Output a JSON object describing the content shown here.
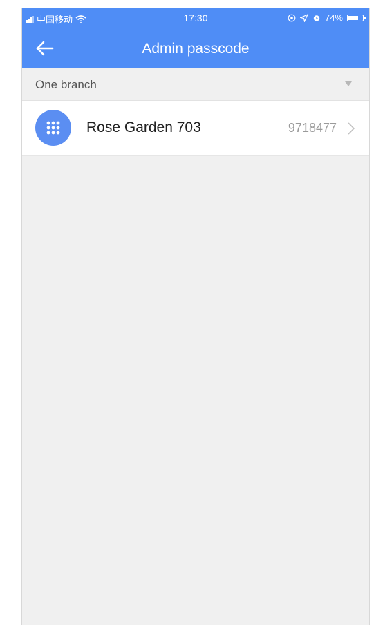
{
  "status_bar": {
    "carrier": "中国移动",
    "time": "17:30",
    "battery": "74%",
    "battery_level": 0.74,
    "icons": [
      "signal-icon",
      "wifi-icon",
      "location-lock-icon",
      "location-arrow-icon",
      "alarm-icon",
      "battery-icon"
    ]
  },
  "header": {
    "title": "Admin passcode",
    "back_icon": "back-arrow-icon"
  },
  "branch_selector": {
    "selected": "One branch",
    "icon": "dropdown-triangle-icon"
  },
  "locks": [
    {
      "name": "Rose Garden 703",
      "passcode": "9718477",
      "icon": "keypad-icon"
    }
  ],
  "colors": {
    "accent": "#4f8df6",
    "avatar": "#5b8ef2",
    "background": "#f0f0f0"
  }
}
